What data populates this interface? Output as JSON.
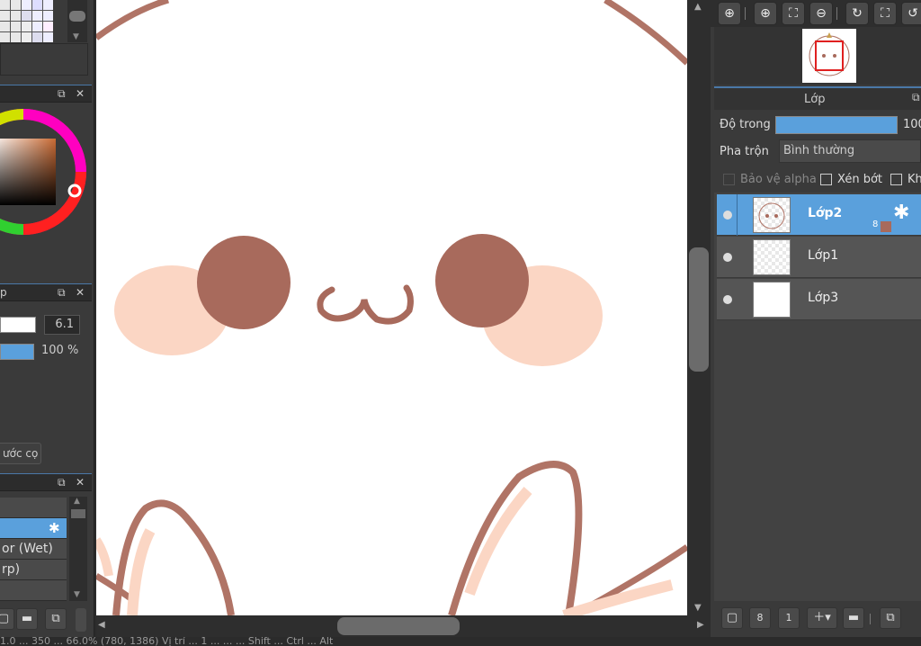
{
  "left_panel": {
    "brush_size_value": "6.1",
    "opacity_value": "100 %",
    "brush_size_button": "ước cọ",
    "brush_list": [
      "or (Wet)",
      "rp)"
    ],
    "panel_label_3": "p"
  },
  "right_panel": {
    "layer_tab_label": "Lớp",
    "opacity_label": "Độ trong",
    "opacity_value": "100",
    "blend_label": "Pha trộn",
    "blend_value": "Bình thường",
    "protect_alpha_label": "Bảo vệ alpha",
    "clip_label": "Xén bớt",
    "lock_label": "Kh",
    "layers": [
      {
        "name": "Lớp2",
        "badge": "8",
        "selected": true
      },
      {
        "name": "Lớp1",
        "selected": false
      },
      {
        "name": "Lớp3",
        "selected": false
      }
    ]
  },
  "status_bar": {
    "text": "1.0 ... 350 ... 66.0% (780, 1386)   Vị trí ... 1 ... ... ... Shift ... Ctrl ... Alt"
  },
  "colors": {
    "accent": "#5aa0dc",
    "character_brown": "#a86a5c",
    "cheek_pink": "#fbd6c4",
    "outline": "#b07466"
  },
  "icons": [
    "zoom-icon",
    "zoom-in-icon",
    "fit-icon",
    "zoom-out-icon",
    "rotate-icon",
    "fullscreen-icon",
    "reset-icon",
    "gear-icon",
    "new-layer-icon",
    "new-8bit-layer-icon",
    "new-1bit-layer-icon",
    "add-layer-icon",
    "folder-icon",
    "duplicate-icon"
  ]
}
